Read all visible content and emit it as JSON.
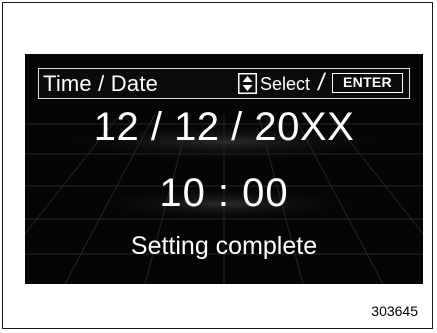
{
  "header": {
    "title": "Time / Date",
    "select_label": "Select",
    "separator": "/",
    "enter_label": "ENTER"
  },
  "main": {
    "date": "12 / 12 / 20XX",
    "time": "10 : 00",
    "status": "Setting complete"
  },
  "figure_ref": "303645",
  "icons": {
    "select": "up-down-arrows-icon",
    "enter": "enter-key-icon"
  },
  "colors": {
    "screen_bg": "#050505",
    "text": "#ffffff",
    "border": "#d8d8d8"
  }
}
